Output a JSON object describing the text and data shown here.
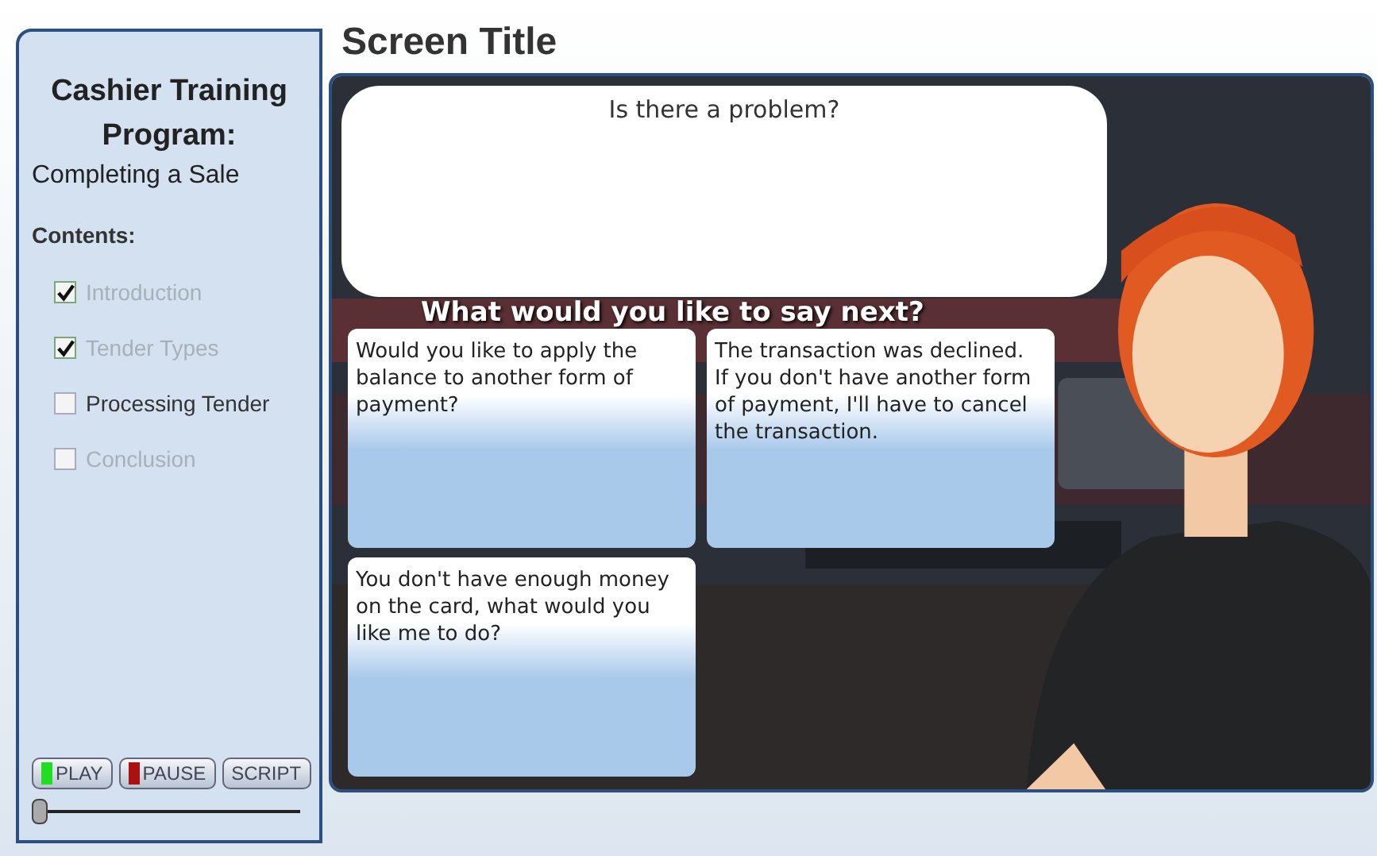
{
  "screen_title": "Screen Title",
  "sidebar": {
    "title": "Cashier Training Program:",
    "subtitle": "Completing a Sale",
    "contents_label": "Contents:",
    "items": [
      {
        "label": "Introduction",
        "checked": true,
        "disabled": true
      },
      {
        "label": "Tender Types",
        "checked": true,
        "disabled": true
      },
      {
        "label": "Processing Tender",
        "checked": false,
        "disabled": false
      },
      {
        "label": "Conclusion",
        "checked": false,
        "disabled": true
      }
    ],
    "buttons": [
      {
        "label": "PLAY",
        "color": "#22dd22"
      },
      {
        "label": "PAUSE",
        "color": "#aa1111"
      },
      {
        "label": "SCRIPT"
      }
    ],
    "progress": {
      "level": 0
    }
  },
  "scene": {
    "speech": "Is there a problem?",
    "prompt": "What would you like to say next?",
    "choices": [
      {
        "text": "Would you like to apply the balance to another form of payment?"
      },
      {
        "text": "The transaction was declined. If you don't have another form of payment, I'll have to cancel the transaction."
      },
      {
        "text": "You don't have enough money on the card, what would you like me to do?"
      }
    ]
  }
}
